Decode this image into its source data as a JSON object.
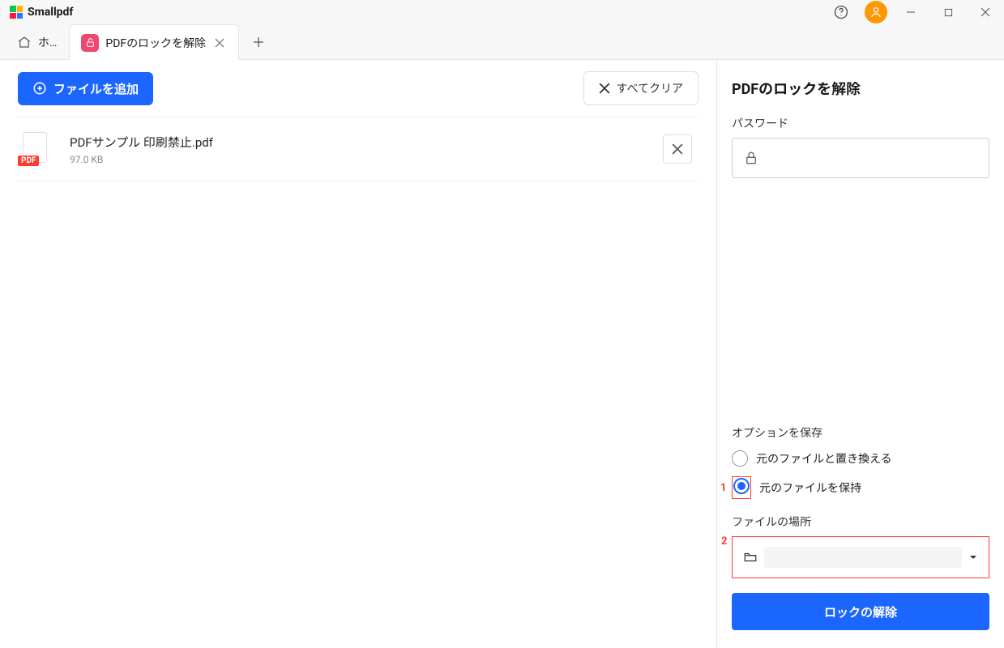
{
  "app": {
    "name": "Smallpdf"
  },
  "tabs": {
    "home_label": "ホ…",
    "items": [
      {
        "label": "PDFのロックを解除"
      }
    ]
  },
  "main": {
    "add_files": "ファイルを追加",
    "clear_all": "すべてクリア",
    "files": [
      {
        "name": "PDFサンプル 印刷禁止.pdf",
        "size": "97.0 KB",
        "badge": "PDF"
      }
    ]
  },
  "side": {
    "title": "PDFのロックを解除",
    "password_label": "パスワード",
    "save_options_label": "オプションを保存",
    "radio_replace": "元のファイルと置き換える",
    "radio_keep": "元のファイルを保持",
    "location_label": "ファイルの場所",
    "unlock_button": "ロックの解除"
  },
  "annotations": {
    "marker1": "1",
    "marker2": "2"
  }
}
